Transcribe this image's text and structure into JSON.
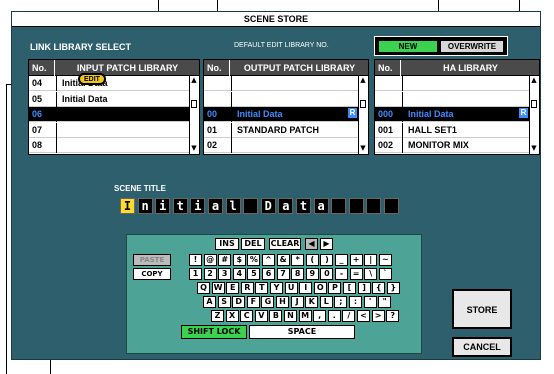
{
  "window": {
    "title": "SCENE STORE"
  },
  "link_library_label": "LINK LIBRARY SELECT",
  "default_edit_label": "DEFAULT EDIT LIBRARY NO.",
  "buttons": {
    "new": "NEW",
    "overwrite": "OVERWRITE",
    "edit": "EDIT",
    "store": "STORE",
    "cancel": "CANCEL"
  },
  "input_patch": {
    "col_no": "No.",
    "col_name": "INPUT PATCH LIBRARY",
    "rows": [
      {
        "no": "04",
        "name": "Initial Data",
        "selected": false
      },
      {
        "no": "05",
        "name": "Initial Data",
        "selected": false
      },
      {
        "no": "06",
        "name": "",
        "selected": true
      },
      {
        "no": "07",
        "name": "",
        "selected": false
      },
      {
        "no": "08",
        "name": "",
        "selected": false
      }
    ]
  },
  "output_patch": {
    "col_no": "No.",
    "col_name": "OUTPUT PATCH LIBRARY",
    "rows": [
      {
        "no": "",
        "name": "",
        "selected": false
      },
      {
        "no": "",
        "name": "",
        "selected": false
      },
      {
        "no": "00",
        "name": "Initial Data",
        "selected": true,
        "flag": "R"
      },
      {
        "no": "01",
        "name": "STANDARD PATCH",
        "selected": false
      },
      {
        "no": "02",
        "name": "",
        "selected": false
      }
    ]
  },
  "ha_library": {
    "col_no": "No.",
    "col_name": "HA LIBRARY",
    "rows": [
      {
        "no": "",
        "name": "",
        "selected": false
      },
      {
        "no": "",
        "name": "",
        "selected": false
      },
      {
        "no": "000",
        "name": "Initial Data",
        "selected": true,
        "flag": "R"
      },
      {
        "no": "001",
        "name": "HALL SET1",
        "selected": false
      },
      {
        "no": "002",
        "name": "MONITOR MIX",
        "selected": false
      }
    ]
  },
  "scene_title": {
    "label": "SCENE TITLE",
    "chars": [
      "I",
      "n",
      "i",
      "t",
      "i",
      "a",
      "l",
      " ",
      "D",
      "a",
      "t",
      "a",
      " ",
      " ",
      " ",
      " "
    ]
  },
  "keyboard": {
    "ins": "INS",
    "del": "DEL",
    "clear": "CLEAR",
    "left": "◀",
    "right": "▶",
    "paste": "PASTE",
    "copy": "COPY",
    "row1": [
      "!",
      "@",
      "#",
      "$",
      "%",
      "^",
      "&",
      "*",
      "(",
      ")",
      "_",
      "+",
      "|",
      "~"
    ],
    "row2": [
      "1",
      "2",
      "3",
      "4",
      "5",
      "6",
      "7",
      "8",
      "9",
      "0",
      "-",
      "=",
      "\\",
      "`"
    ],
    "row3": [
      "Q",
      "W",
      "E",
      "R",
      "T",
      "Y",
      "U",
      "I",
      "O",
      "P",
      "[",
      "]",
      "{",
      "}"
    ],
    "row4": [
      "A",
      "S",
      "D",
      "F",
      "G",
      "H",
      "J",
      "K",
      "L",
      ";",
      ":",
      "'",
      "\""
    ],
    "row5": [
      "Z",
      "X",
      "C",
      "V",
      "B",
      "N",
      "M",
      ",",
      ".",
      "/",
      "<",
      ">",
      "?"
    ],
    "shift_lock": "SHIFT LOCK",
    "space": "SPACE"
  }
}
